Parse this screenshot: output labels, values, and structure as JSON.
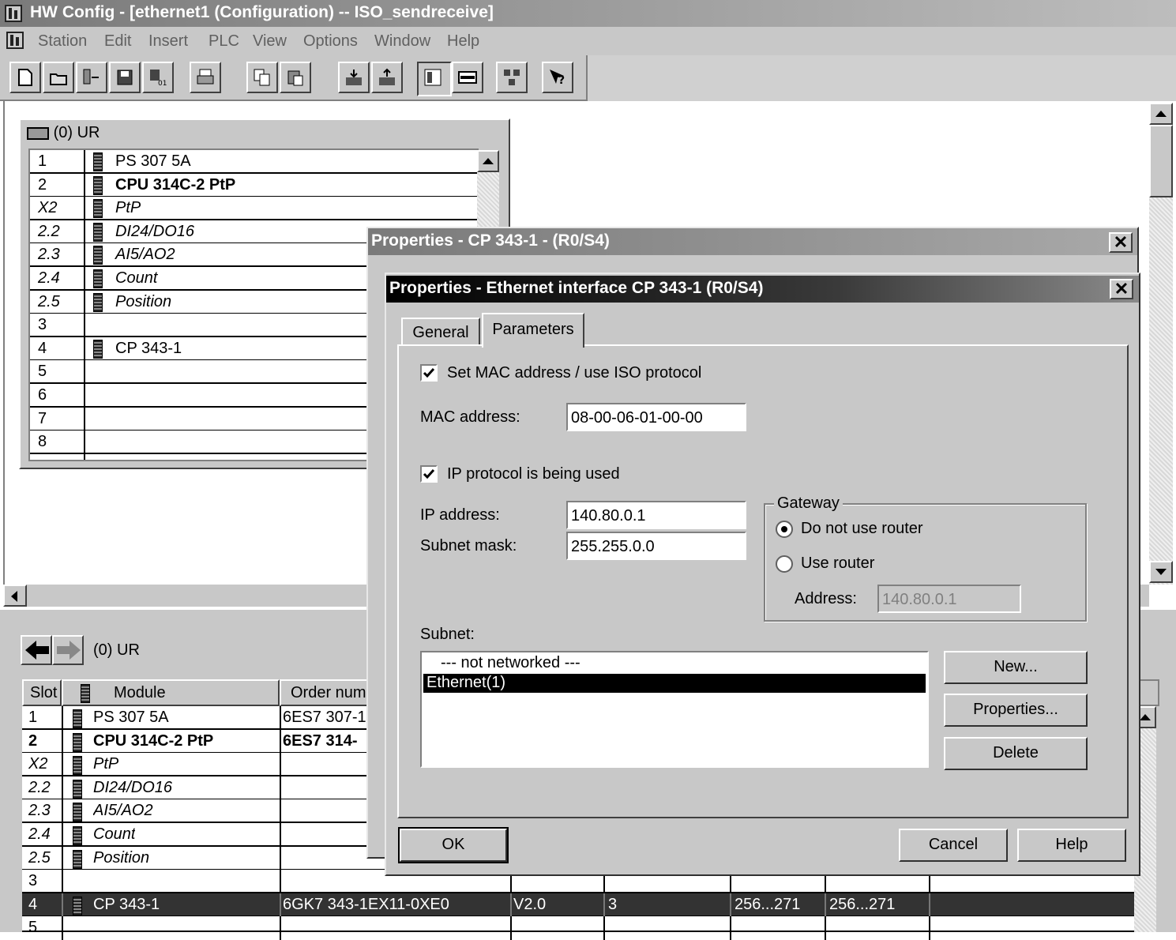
{
  "window": {
    "title": "HW Config - [ethernet1 (Configuration) -- ISO_sendreceive]"
  },
  "menu": [
    "Station",
    "Edit",
    "Insert",
    "PLC",
    "View",
    "Options",
    "Window",
    "Help"
  ],
  "toolbar": {
    "icons": [
      "new-icon",
      "open-icon",
      "accessible-nodes-icon",
      "save-icon",
      "save-compile-icon",
      "print-icon",
      "copy-icon",
      "paste-icon",
      "download-icon",
      "upload-icon",
      "catalog-icon",
      "network-view-icon",
      "configure-network-icon",
      "help-context-icon"
    ]
  },
  "rack": {
    "title": "(0) UR",
    "rows": [
      {
        "slot": "1",
        "module": "PS 307 5A",
        "style": "normal"
      },
      {
        "slot": "2",
        "module": "CPU 314C-2 PtP",
        "style": "bold"
      },
      {
        "slot": "X2",
        "module": "PtP",
        "style": "italic"
      },
      {
        "slot": "2.2",
        "module": "DI24/DO16",
        "style": "italic"
      },
      {
        "slot": "2.3",
        "module": "AI5/AO2",
        "style": "italic"
      },
      {
        "slot": "2.4",
        "module": "Count",
        "style": "italic"
      },
      {
        "slot": "2.5",
        "module": "Position",
        "style": "italic"
      },
      {
        "slot": "3",
        "module": "",
        "style": "normal"
      },
      {
        "slot": "4",
        "module": "CP 343-1",
        "style": "normal"
      },
      {
        "slot": "5",
        "module": "",
        "style": "normal"
      },
      {
        "slot": "6",
        "module": "",
        "style": "normal"
      },
      {
        "slot": "7",
        "module": "",
        "style": "normal"
      },
      {
        "slot": "8",
        "module": "",
        "style": "normal"
      }
    ]
  },
  "lower": {
    "nav_title": "(0)   UR",
    "headers": {
      "slot": "Slot",
      "module": "Module",
      "order": "Order numb"
    },
    "rows": [
      {
        "slot": "1",
        "module": "PS 307 5A",
        "order": "6ES7 307-1",
        "fw": "",
        "mpi": "",
        "i": "",
        "q": "",
        "style": "normal"
      },
      {
        "slot": "2",
        "module": "CPU 314C-2 PtP",
        "order": "6ES7 314-",
        "fw": "",
        "mpi": "",
        "i": "",
        "q": "",
        "style": "bold"
      },
      {
        "slot": "X2",
        "module": "PtP",
        "order": "",
        "fw": "",
        "mpi": "",
        "i": "",
        "q": "",
        "style": "italic"
      },
      {
        "slot": "2.2",
        "module": "DI24/DO16",
        "order": "",
        "fw": "",
        "mpi": "",
        "i": "",
        "q": "",
        "style": "italic"
      },
      {
        "slot": "2.3",
        "module": "AI5/AO2",
        "order": "",
        "fw": "",
        "mpi": "",
        "i": "",
        "q": "",
        "style": "italic"
      },
      {
        "slot": "2.4",
        "module": "Count",
        "order": "",
        "fw": "",
        "mpi": "",
        "i": "",
        "q": "",
        "style": "italic"
      },
      {
        "slot": "2.5",
        "module": "Position",
        "order": "",
        "fw": "",
        "mpi": "",
        "i": "",
        "q": "",
        "style": "italic"
      },
      {
        "slot": "3",
        "module": "",
        "order": "",
        "fw": "",
        "mpi": "",
        "i": "",
        "q": "",
        "style": "normal"
      },
      {
        "slot": "4",
        "module": "CP 343-1",
        "order": "6GK7 343-1EX11-0XE0",
        "fw": "V2.0",
        "mpi": "3",
        "i": "256...271",
        "q": "256...271",
        "style": "selected"
      },
      {
        "slot": "5",
        "module": "",
        "order": "",
        "fw": "",
        "mpi": "",
        "i": "",
        "q": "",
        "style": "normal"
      }
    ]
  },
  "outer_dialog": {
    "title": "Properties - CP 343-1 - (R0/S4)"
  },
  "dialog": {
    "title": "Properties - Ethernet interface  CP 343-1 (R0/S4)",
    "tabs": [
      "General",
      "Parameters"
    ],
    "set_mac_label": "Set MAC address / use ISO protocol",
    "mac_label": "MAC address:",
    "mac_value": "08-00-06-01-00-00",
    "ip_used_label": "IP protocol is being used",
    "ip_label": "IP address:",
    "ip_value": "140.80.0.1",
    "subnet_mask_label": "Subnet mask:",
    "subnet_mask_value": "255.255.0.0",
    "gateway": {
      "title": "Gateway",
      "no_router": "Do not use router",
      "use_router": "Use router",
      "address_label": "Address:",
      "address_value": "140.80.0.1"
    },
    "subnet_label": "Subnet:",
    "subnets": [
      "--- not networked ---",
      "Ethernet(1)"
    ],
    "buttons": {
      "new": "New...",
      "properties": "Properties...",
      "delete": "Delete",
      "ok": "OK",
      "cancel": "Cancel",
      "help": "Help"
    }
  }
}
